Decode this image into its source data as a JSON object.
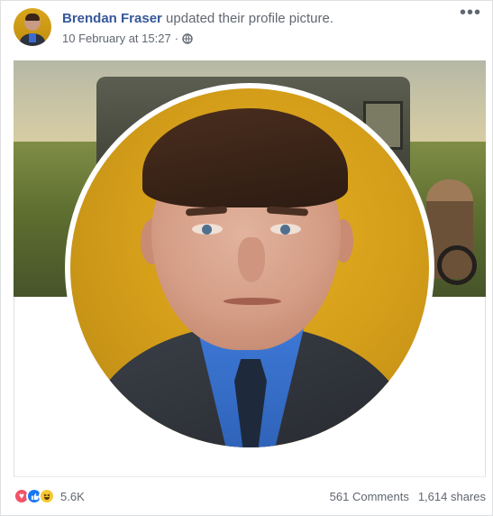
{
  "post": {
    "author": "Brendan Fraser",
    "action": "updated their profile picture.",
    "timestamp": "10 February at 15:27",
    "separator": "·",
    "privacy_icon": "globe-icon",
    "more_icon": "ellipsis-icon",
    "more_label": "•••"
  },
  "reactions": {
    "icons": [
      "love-icon",
      "like-icon",
      "haha-icon"
    ],
    "count": "5.6K",
    "comments": "561 Comments",
    "shares": "1,614 shares"
  },
  "colors": {
    "author_link": "#365899",
    "meta_text": "#616770",
    "love": "#f25268",
    "like": "#1877f2",
    "haha": "#f7c833",
    "profile_background": "#d59f1a"
  }
}
